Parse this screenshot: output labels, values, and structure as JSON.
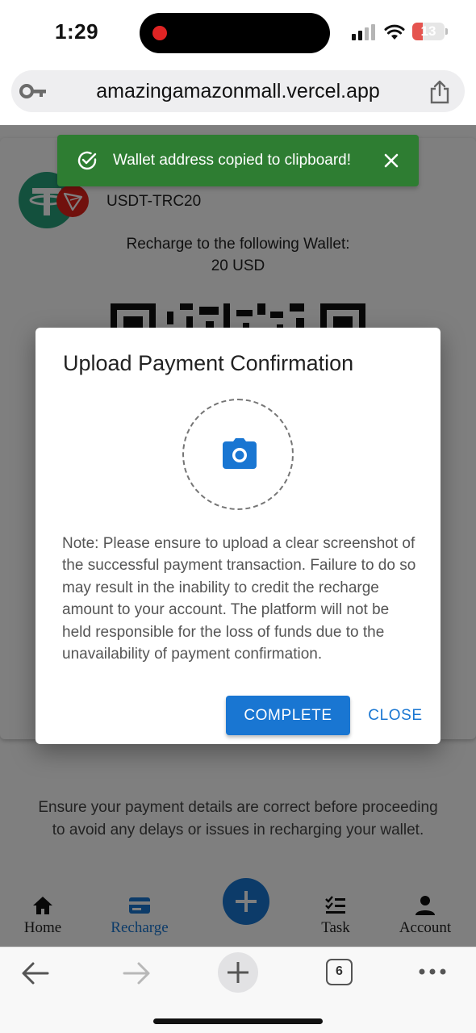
{
  "status_bar": {
    "time": "1:29",
    "battery_level": "13",
    "colors": {
      "recording_dot": "#e02424",
      "battery_low": "#e5544f"
    }
  },
  "browser": {
    "url": "amazingamazonmall.vercel.app",
    "tab_count": "6",
    "icons": [
      "key-icon",
      "share-icon",
      "back-arrow-icon",
      "forward-arrow-icon",
      "plus-icon",
      "tabs-icon",
      "more-icon"
    ]
  },
  "card": {
    "coin_name": "USDT-TRC20",
    "recharge_label": "Recharge to the following Wallet:",
    "recharge_amount": "20 USD"
  },
  "snackbar": {
    "message": "Wallet address copied to clipboard!",
    "color": "#2e7d32"
  },
  "dialog": {
    "title": "Upload Payment Confirmation",
    "note": "Note: Please ensure to upload a clear screenshot of the successful payment transaction. Failure to do so may result in the inability to credit the recharge amount to your account. The platform will not be held responsible for the loss of funds due to the unavailability of payment confirmation.",
    "complete_label": "COMPLETE",
    "close_label": "CLOSE",
    "accent": "#1976d2"
  },
  "footer_note": "Ensure your payment details are correct before proceeding to avoid any delays or issues in recharging your wallet.",
  "bottom_nav": {
    "active": "Recharge",
    "items": [
      {
        "label": "Home",
        "icon": "home-icon"
      },
      {
        "label": "Recharge",
        "icon": "credit-card-icon"
      },
      {
        "label": "",
        "icon": "plus-icon"
      },
      {
        "label": "Task",
        "icon": "checklist-icon"
      },
      {
        "label": "Account",
        "icon": "person-icon"
      }
    ]
  }
}
